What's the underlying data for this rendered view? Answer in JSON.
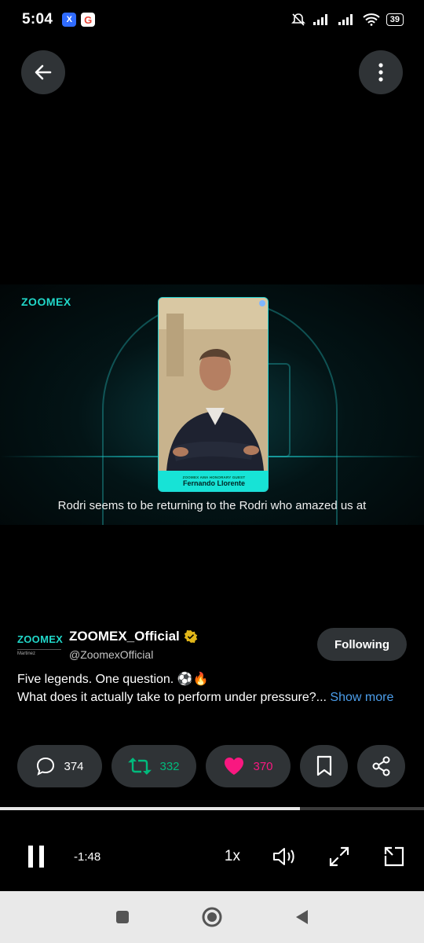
{
  "status_bar": {
    "time": "5:04",
    "app_badges": [
      "X",
      "G"
    ],
    "battery": "39"
  },
  "video": {
    "brand": "ZOOMEX",
    "card_subtitle": "ZOOMEX AMA HONORARY GUEST",
    "card_name": "Fernando Llorente",
    "caption": "Rodri seems to be returning to the Rodri who amazed us at"
  },
  "author": {
    "avatar_brand": "ZOOMEX",
    "avatar_sub": "Martinez",
    "name": "ZOOMEX_Official",
    "handle": "@ZoomexOfficial",
    "follow_label": "Following"
  },
  "tweet": {
    "line1": "Five legends. One question. ⚽🔥",
    "line2": "What does it actually take to perform under pressure?... ",
    "show_more": "Show more"
  },
  "actions": {
    "replies": "374",
    "reposts": "332",
    "likes": "370"
  },
  "player": {
    "progress": 0.707,
    "time_remaining": "-1:48",
    "speed": "1x"
  },
  "colors": {
    "accent_blue": "#4c9eeb",
    "repost_green": "#00ba7c",
    "like_pink": "#f91880",
    "brand_teal": "#21d7c9"
  }
}
